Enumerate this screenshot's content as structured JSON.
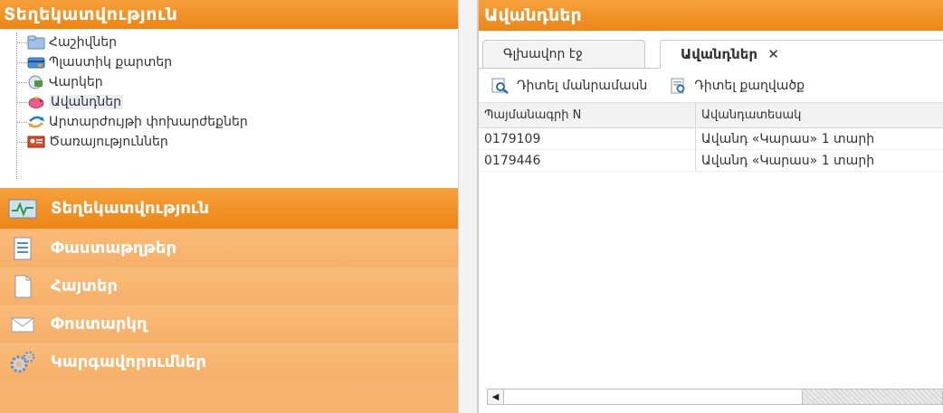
{
  "left_panel": {
    "title": "Տեղեկատվություն",
    "tree": [
      {
        "label": "Հաշիվներ",
        "icon": "folder-icon"
      },
      {
        "label": "Պլաստիկ քարտեր",
        "icon": "credit-card-icon"
      },
      {
        "label": "Վարկեր",
        "icon": "loan-icon"
      },
      {
        "label": "Ավանդներ",
        "icon": "piggy-bank-icon",
        "selected": true
      },
      {
        "label": "Արտարժույթի փոխարժեքներ",
        "icon": "exchange-arrows-icon"
      },
      {
        "label": "Ծառայություններ",
        "icon": "services-icon"
      }
    ],
    "nav": [
      {
        "label": "Տեղեկատվություն",
        "icon": "monitor-chart-icon",
        "active": true
      },
      {
        "label": "Փաստաթղթեր",
        "icon": "documents-icon"
      },
      {
        "label": "Հայտեր",
        "icon": "page-icon"
      },
      {
        "label": "Փոստարկղ",
        "icon": "envelope-icon"
      },
      {
        "label": "Կարգավորումներ",
        "icon": "gears-icon"
      }
    ]
  },
  "right_panel": {
    "title": "Ավանդներ",
    "tabs": [
      {
        "label": "Գլխավոր էջ"
      },
      {
        "label": "Ավանդներ",
        "close": "✕",
        "active": true
      }
    ],
    "toolbar": {
      "view_details": "Դիտել մանրամասն",
      "view_statement": "Դիտել քաղվածք"
    },
    "table": {
      "columns": [
        "Պայմանագրի N",
        "Ավանդատեսակ"
      ],
      "rows": [
        [
          "0179109",
          "Ավանդ «Կարաս» 1 տարի"
        ],
        [
          "0179446",
          "Ավանդ «Կարաս» 1 տարի"
        ]
      ]
    }
  },
  "colors": {
    "orange_header": "#ec8515",
    "orange_light": "#f7b471"
  }
}
